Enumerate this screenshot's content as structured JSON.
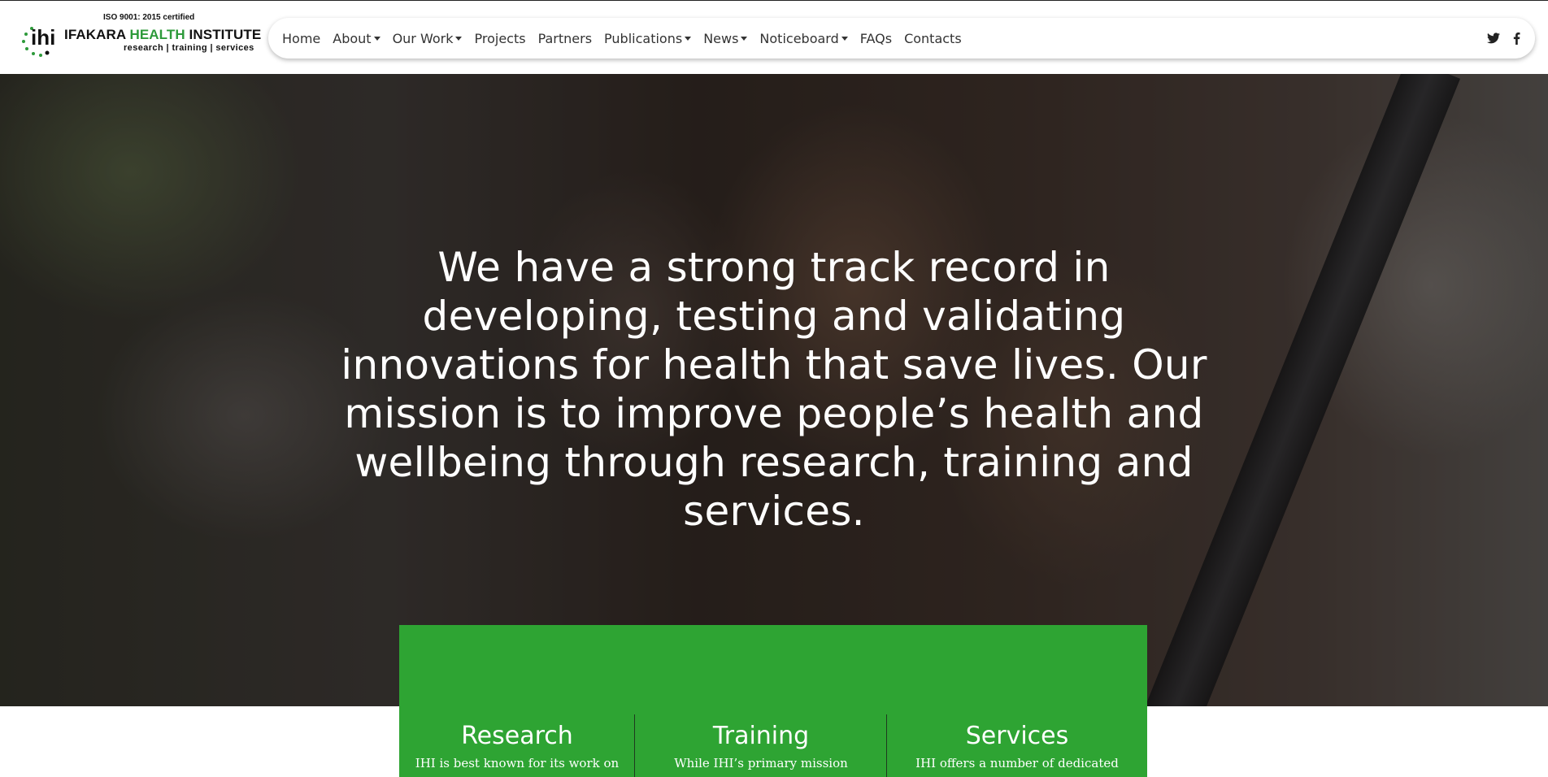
{
  "logo": {
    "iso": "ISO 9001: 2015 certified",
    "name_part1": "IFAKARA ",
    "name_part2": "HEALTH",
    "name_part3": " INSTITUTE",
    "tagline": "research | training | services",
    "brand_green": "#2d9a3a"
  },
  "nav": {
    "items": [
      {
        "label": "Home",
        "dropdown": false
      },
      {
        "label": "About",
        "dropdown": true
      },
      {
        "label": "Our Work",
        "dropdown": true
      },
      {
        "label": "Projects",
        "dropdown": false
      },
      {
        "label": "Partners",
        "dropdown": false
      },
      {
        "label": "Publications",
        "dropdown": true
      },
      {
        "label": "News",
        "dropdown": true
      },
      {
        "label": "Noticeboard",
        "dropdown": true
      },
      {
        "label": "FAQs",
        "dropdown": false
      },
      {
        "label": "Contacts",
        "dropdown": false
      }
    ],
    "social": [
      "twitter-icon",
      "facebook-icon"
    ]
  },
  "hero": {
    "statement": "We have a strong track record in developing, testing and validating innovations for health that save lives. Our mission is to improve people’s health and wellbeing through research, training and services."
  },
  "pillars": {
    "accent": "#2ea433",
    "items": [
      {
        "title": "Research",
        "text": "IHI is best known for its work on"
      },
      {
        "title": "Training",
        "text": "While IHI’s primary mission"
      },
      {
        "title": "Services",
        "text": "IHI offers a number of dedicated"
      }
    ]
  }
}
